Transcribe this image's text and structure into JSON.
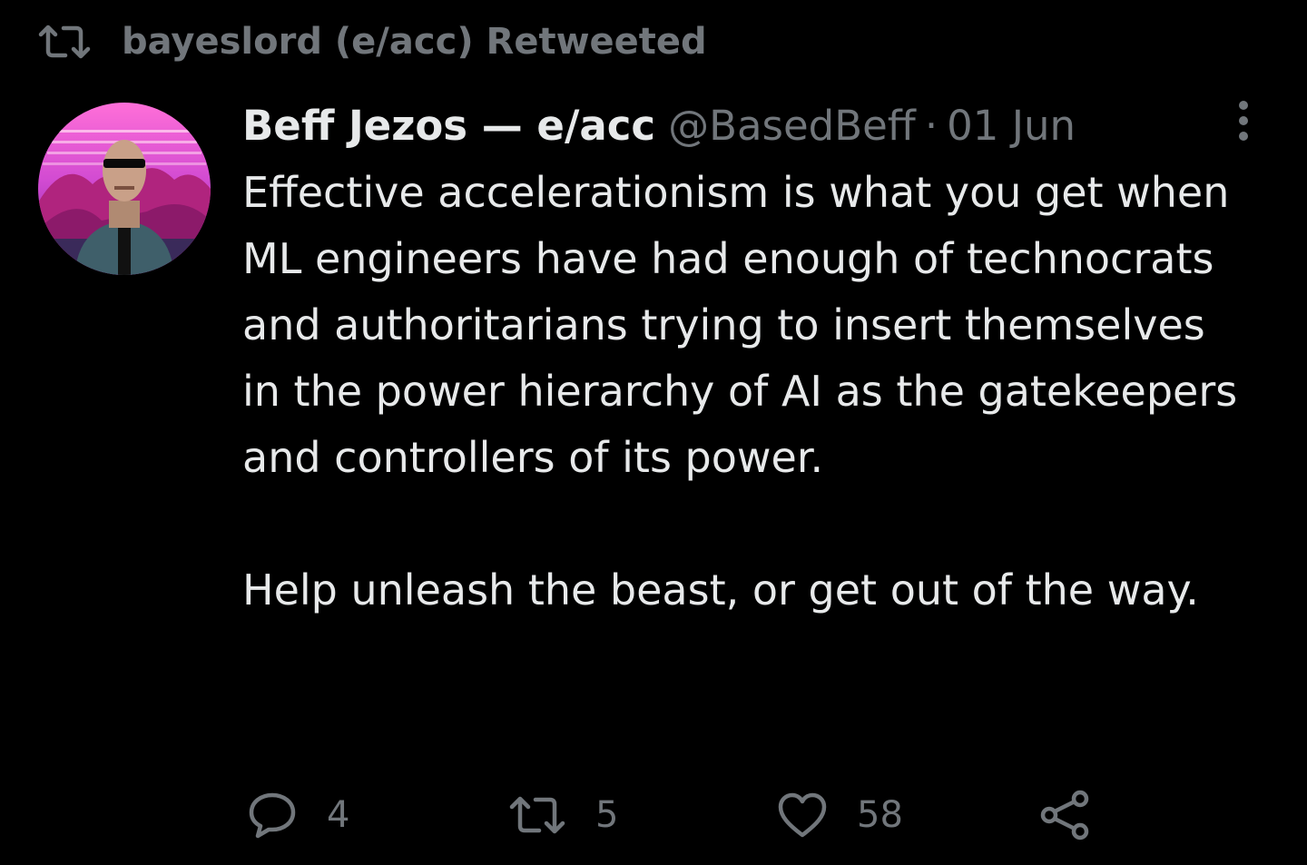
{
  "social_context": {
    "icon": "retweet-icon",
    "text": "bayeslord (e/acc) Retweeted"
  },
  "tweet": {
    "avatar": "avatar",
    "display_name": "Beff Jezos — e/acc",
    "handle": "@BasedBeff",
    "separator": "·",
    "date": "01 Jun",
    "more_icon": "more-vertical-icon",
    "paragraphs": [
      "Effective accelerationism is what you get when ML engineers have had enough of technocrats and authoritarians trying to insert themselves in the power hierarchy of AI as the gatekeepers and controllers of its power.",
      "Help unleash the beast, or get out of the way."
    ]
  },
  "actions": {
    "reply": {
      "icon": "reply-icon",
      "count": "4"
    },
    "retweet": {
      "icon": "retweet-icon",
      "count": "5"
    },
    "like": {
      "icon": "heart-icon",
      "count": "58"
    },
    "share": {
      "icon": "share-icon"
    }
  },
  "colors": {
    "background": "#000000",
    "primary_text": "#e7e9ea",
    "secondary_text": "#71767b"
  }
}
